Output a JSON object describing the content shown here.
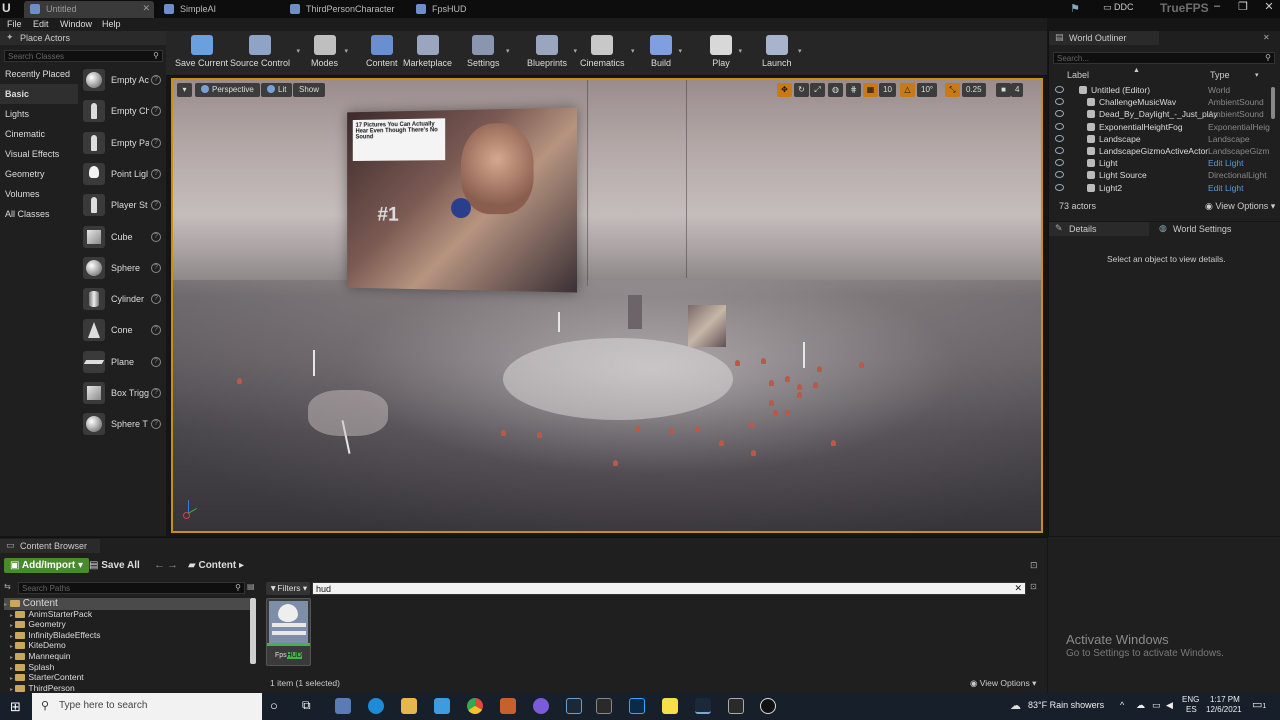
{
  "tabs": [
    {
      "label": "Untitled",
      "active": true
    },
    {
      "label": "SimpleAI"
    },
    {
      "label": "ThirdPersonCharacter"
    },
    {
      "label": "FpsHUD"
    }
  ],
  "titlebar": {
    "ddc": "DDC",
    "project": "TrueFPS"
  },
  "menu": [
    "File",
    "Edit",
    "Window",
    "Help"
  ],
  "place_actors": {
    "title": "Place Actors",
    "search_placeholder": "Search Classes",
    "categories": [
      "Recently Placed",
      "Basic",
      "Lights",
      "Cinematic",
      "Visual Effects",
      "Geometry",
      "Volumes",
      "All Classes"
    ],
    "selected_category": "Basic",
    "actors": [
      {
        "label": "Empty Ac",
        "icon": "sphere"
      },
      {
        "label": "Empty Ch",
        "icon": "figure"
      },
      {
        "label": "Empty Pa",
        "icon": "figure"
      },
      {
        "label": "Point Ligl",
        "icon": "bulb"
      },
      {
        "label": "Player St",
        "icon": "figure"
      },
      {
        "label": "Cube",
        "icon": "cube"
      },
      {
        "label": "Sphere",
        "icon": "sphere"
      },
      {
        "label": "Cylinder",
        "icon": "cyl"
      },
      {
        "label": "Cone",
        "icon": "cone"
      },
      {
        "label": "Plane",
        "icon": "plane"
      },
      {
        "label": "Box Trigg",
        "icon": "cube"
      },
      {
        "label": "Sphere T",
        "icon": "sphere"
      }
    ],
    "help_glyph": "?"
  },
  "toolbar": [
    {
      "label": "Save Current",
      "color": "#6a9fe0",
      "caret": false
    },
    {
      "label": "Source Control",
      "color": "#8fa3c7",
      "caret": true
    },
    {
      "label": "Modes",
      "color": "#bfbfbf",
      "caret": true
    },
    {
      "label": "Content",
      "color": "#6a8fd0",
      "caret": false
    },
    {
      "label": "Marketplace",
      "color": "#9aa6c0",
      "caret": false
    },
    {
      "label": "Settings",
      "color": "#8a96b0",
      "caret": true
    },
    {
      "label": "Blueprints",
      "color": "#9aa6c0",
      "caret": true
    },
    {
      "label": "Cinematics",
      "color": "#c8c8c8",
      "caret": true
    },
    {
      "label": "Build",
      "color": "#7f9fe0",
      "caret": true
    },
    {
      "label": "Play",
      "color": "#d8d8d8",
      "caret": true
    },
    {
      "label": "Launch",
      "color": "#a8b4cc",
      "caret": true
    }
  ],
  "viewport": {
    "perspective": "Perspective",
    "lit": "Lit",
    "show": "Show",
    "grid_snap": "10",
    "rot_snap": "10°",
    "scale_snap": "0.25",
    "camera_speed": "4",
    "billboard_caption": "17 Pictures You Can Actually Hear Even Though There's No Sound",
    "billboard_number": "#1"
  },
  "outliner": {
    "title": "World Outliner",
    "search_placeholder": "Search...",
    "col_label": "Label",
    "col_type": "Type",
    "rows": [
      {
        "label": "Untitled (Editor)",
        "type": "World",
        "link": false
      },
      {
        "label": "ChallengeMusicWav",
        "type": "AmbientSound",
        "link": false
      },
      {
        "label": "Dead_By_Daylight_-_Just_play",
        "type": "AmbientSound",
        "link": false
      },
      {
        "label": "ExponentialHeightFog",
        "type": "ExponentialHeig",
        "link": false
      },
      {
        "label": "Landscape",
        "type": "Landscape",
        "link": false
      },
      {
        "label": "LandscapeGizmoActiveActor",
        "type": "LandscapeGizm",
        "link": false
      },
      {
        "label": "Light",
        "type": "Edit Light",
        "link": true
      },
      {
        "label": "Light Source",
        "type": "DirectionalLight",
        "link": false
      },
      {
        "label": "Light2",
        "type": "Edit Light",
        "link": true
      }
    ],
    "count": "73 actors",
    "view_options": "View Options"
  },
  "details": {
    "tab_details": "Details",
    "tab_world": "World Settings",
    "empty": "Select an object to view details."
  },
  "content_browser": {
    "title": "Content Browser",
    "add_import": "Add/Import",
    "save_all": "Save All",
    "path": "Content",
    "search_paths": "Search Paths",
    "filters": "Filters",
    "search_value": "hud",
    "tree": [
      "Content",
      "AnimStarterPack",
      "Geometry",
      "InfinityBladeEffects",
      "KiteDemo",
      "Mannequin",
      "Splash",
      "StarterContent",
      "ThirdPerson"
    ],
    "asset_name_pre": "Fps",
    "asset_name_match": "HUD",
    "status": "1 item (1 selected)",
    "view_options": "View Options"
  },
  "activate": {
    "line1": "Activate Windows",
    "line2": "Go to Settings to activate Windows."
  },
  "taskbar": {
    "search": "Type here to search",
    "weather": "83°F  Rain showers",
    "lang1": "ENG",
    "lang2": "ES",
    "time": "1:17 PM",
    "date": "12/6/2021",
    "notif": "1"
  }
}
